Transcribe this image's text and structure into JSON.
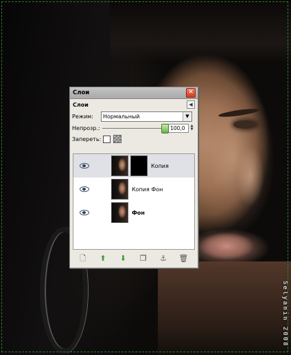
{
  "dialog": {
    "window_title": "Слои",
    "header_label": "Слои",
    "mode_label": "Режим:",
    "mode_value": "Нормальный",
    "opacity_label": "Непрозр.:",
    "opacity_value": "100,0",
    "opacity_fraction": 1.0,
    "lock_label": "Запереть:"
  },
  "layers": [
    {
      "name": "Копия",
      "selected": true,
      "has_mask": true,
      "bold": false
    },
    {
      "name": "Копия Фон",
      "selected": false,
      "has_mask": false,
      "bold": false
    },
    {
      "name": "Фон",
      "selected": false,
      "has_mask": false,
      "bold": true
    }
  ],
  "buttons": [
    "new-layer-icon",
    "raise-layer-icon",
    "lower-layer-icon",
    "duplicate-layer-icon",
    "anchor-layer-icon",
    "delete-layer-icon"
  ],
  "watermark": "Selyanin 2008",
  "colors": {
    "canvas_guide": "#2e7d2e",
    "close_button": "#d23b1e",
    "arrow_green": "#3f9a2f"
  }
}
